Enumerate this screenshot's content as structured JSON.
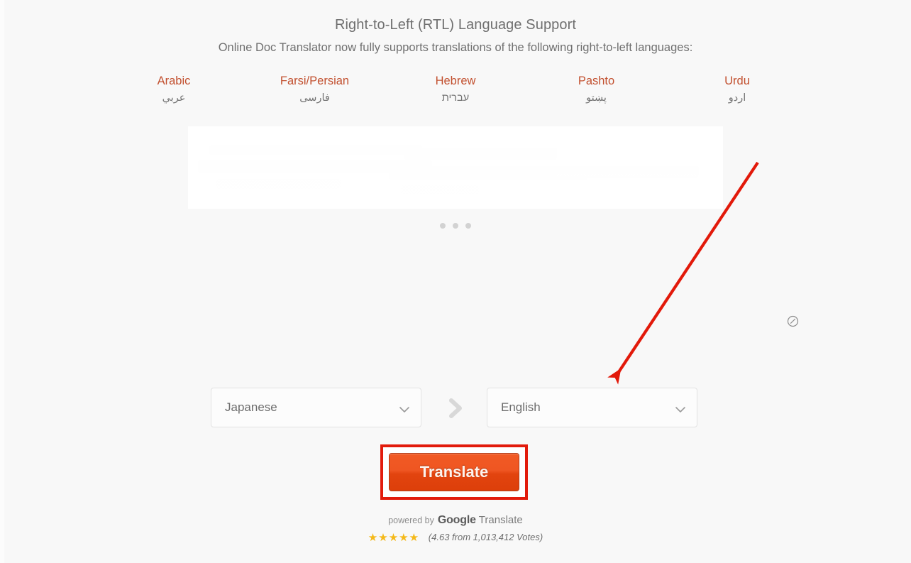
{
  "promo": {
    "title": "Right-to-Left (RTL) Language Support",
    "subtitle": "Online Doc Translator now fully supports translations of the following right-to-left languages:",
    "languages": [
      {
        "name": "Arabic",
        "native": "عربي"
      },
      {
        "name": "Farsi/Persian",
        "native": "فارسی"
      },
      {
        "name": "Hebrew",
        "native": "עברית"
      },
      {
        "name": "Pashto",
        "native": "پښتو"
      },
      {
        "name": "Urdu",
        "native": "اردو"
      }
    ],
    "accent_color": "#c2502f"
  },
  "carousel": {
    "dots": 3,
    "active_dot": 0
  },
  "ads": {
    "adchoices_icon": "adchoices-circle-slash-icon"
  },
  "translator": {
    "source_language": "Japanese",
    "target_language": "English",
    "direction_icon": "chevron-right-icon",
    "dropdown_icon": "chevron-down-icon",
    "translate_label": "Translate"
  },
  "footer": {
    "powered_prefix": "powered by",
    "google": "Google",
    "translate_word": "Translate",
    "stars_glyphs": "★★★★★",
    "rating_fill_percent": 90,
    "votes_text": "(4.63 from 1,013,412 Votes)"
  },
  "annotations": {
    "arrow_color": "#e2190a",
    "highlight_color": "#e21b0c",
    "arrow_name": "red-arrow-pointing-to-target-language",
    "highlight_name": "red-box-around-translate-button"
  }
}
